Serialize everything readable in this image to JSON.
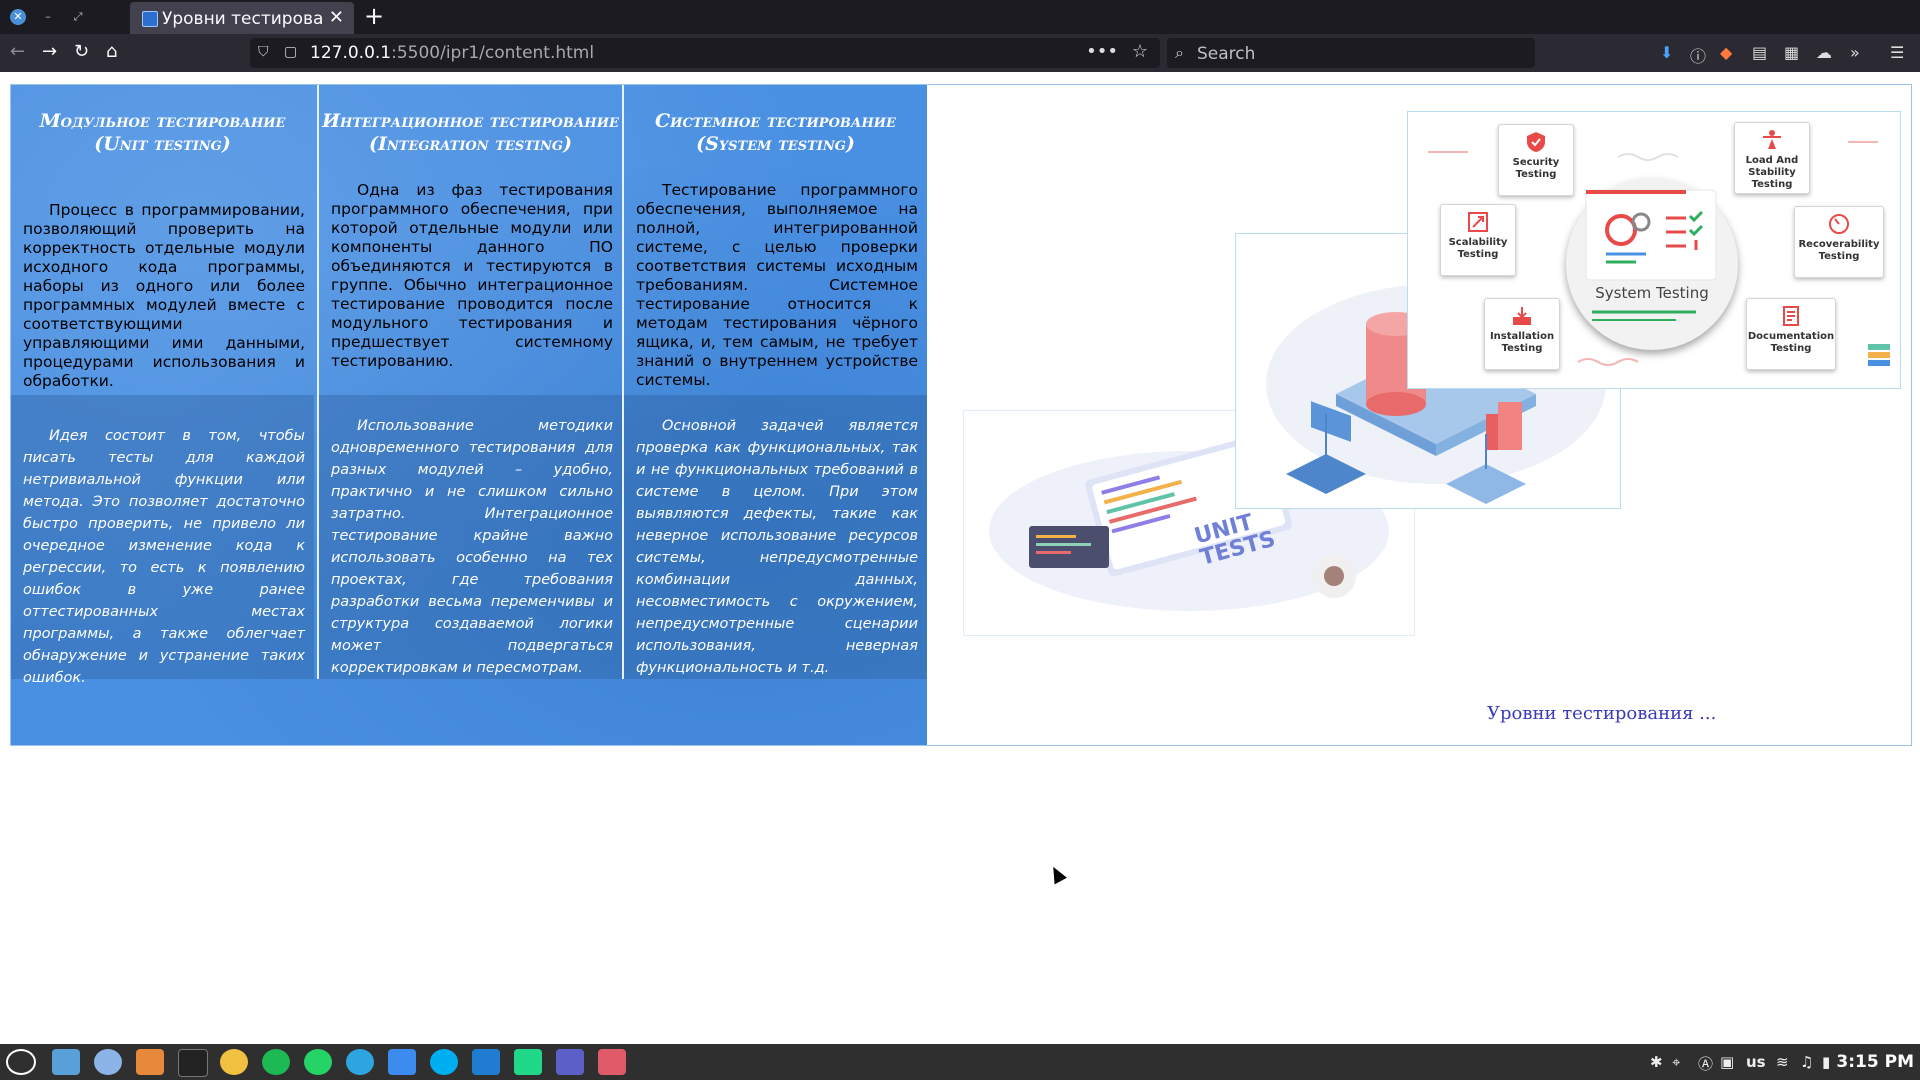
{
  "browser": {
    "tab_title": "Уровни тестирования",
    "new_tab": "+",
    "url_host": "127.0.0.1",
    "url_rest": ":5500/ipr1/content.html",
    "search_placeholder": "Search",
    "url_menu": "•••"
  },
  "columns": [
    {
      "title": "Модульное тестирование (Unit testing)",
      "description": "Процесс в программировании, позволяющий проверить на корректность отдельные модули исходного кода программы, наборы из одного или более программных модулей вместе с соответствующими управляющими ими данными, процедурами использования и обработки.",
      "note": "Идея состоит в том, чтобы писать тесты для каждой нетривиальной функции или метода. Это позволяет достаточно быстро проверить, не привело ли очередное изменение кода к регрессии, то есть к появлению ошибок в уже ранее оттестированных местах программы, а также облегчает обнаружение и устранение таких ошибок."
    },
    {
      "title": "Интеграционное тестирование (Integration testing)",
      "description": "Одна из фаз тестирования программного обеспечения, при которой отдельные модули или компоненты данного ПО объединяются и тестируются в группе. Обычно интеграционное тестирование проводится после модульного тестирования и предшествует системному тестированию.",
      "note": "Использование методики одновременного тестирования для разных модулей – удобно, практично и не слишком сильно затратно. Интеграционное тестирование крайне важно использовать особенно на тех проектах, где требования разработки весьма переменчивы и структура создаваемой логики может подвергаться корректировкам и пересмотрам."
    },
    {
      "title": "Системное тестирование (System testing)",
      "description": "Тестирование программного обеспечения, выполняемое на полной, интегрированной системе, с целью проверки соответствия системы исходным требованиям. Системное тестирование относится к методам тестирования чёрного ящика, и, тем самым, не требует знаний о внутреннем устройстве системы.",
      "note": "Основной задачей является проверка как функциональных, так и не функциональных требований в системе в целом. При этом выявляются дефекты, такие как неверное использование ресурсов системы, непредусмотренные комбинации данных, несовместимость с окружением, непредусмотренные сценарии использования, неверная функциональность и т.д."
    }
  ],
  "illustrations": {
    "unit_label": "UNIT TESTS",
    "system_center": "System Testing",
    "system_cards": [
      "Security Testing",
      "Load And Stability Testing",
      "Scalability Testing",
      "Recoverability Testing",
      "Installation Testing",
      "Documentation Testing"
    ]
  },
  "caption": "Уровни тестирования ...",
  "taskbar": {
    "layout": "us",
    "time": "3:15 PM"
  },
  "colors": {
    "panel_blue": "#4a90e2",
    "caption_link": "#3a3abf"
  }
}
